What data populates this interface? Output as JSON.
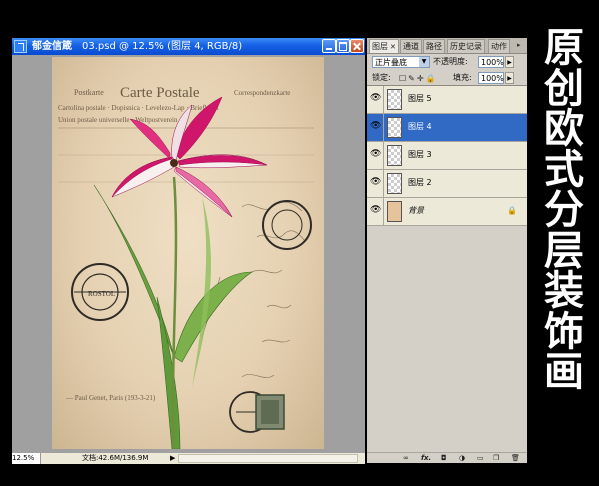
{
  "document": {
    "app_title": "郁金信箴",
    "file_title": "03.psd @ 12.5% (图层 4, RGB/8)",
    "status_zoom": "12.5%",
    "status_doc": "文档:42.6M/136.9M",
    "artwork": {
      "stamp_heading": "Postkarte · Carte Postale · Correspondenzkarte",
      "line2": "Cartolina postale · Dopisnica · Levelezo-Lap · Briefkaart",
      "line3": "Union postale universelle · Weltpostverein",
      "caption": "Paul Genet, Paris",
      "accent_colors": [
        "#d0166b",
        "#e86aa4",
        "#5f9a3a",
        "#3f4a35"
      ]
    }
  },
  "panel": {
    "tabs": [
      {
        "label": "图层",
        "active": true
      },
      {
        "label": "通道",
        "active": false
      },
      {
        "label": "路径",
        "active": false
      },
      {
        "label": "历史记录",
        "active": false
      },
      {
        "label": "动作",
        "active": false
      }
    ],
    "blend_mode": "正片叠底",
    "opacity_label": "不透明度:",
    "opacity_value": "100%",
    "lock_label": "锁定:",
    "fill_label": "填充:",
    "fill_value": "100%",
    "layers": [
      {
        "name": "图层 5",
        "selected": false
      },
      {
        "name": "图层 4",
        "selected": true
      },
      {
        "name": "图层 3",
        "selected": false
      },
      {
        "name": "图层 2",
        "selected": false
      },
      {
        "name": "背景",
        "selected": false,
        "locked": true
      }
    ],
    "bottom_icons": [
      "link-icon",
      "fx-icon",
      "mask-icon",
      "adjustment-icon",
      "group-icon",
      "new-layer-icon",
      "trash-icon"
    ]
  },
  "caption_lines": [
    "原",
    "创",
    "欧",
    "式",
    "分",
    "层",
    "装",
    "饰",
    "画"
  ]
}
